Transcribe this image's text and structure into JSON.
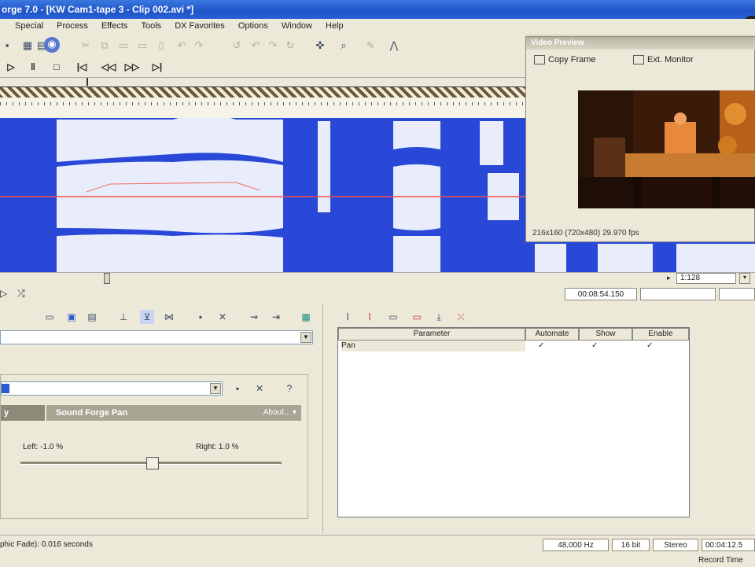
{
  "window": {
    "title": "orge 7.0 - [KW Cam1-tape 3 - Clip 002.avi *]"
  },
  "menu": [
    "Special",
    "Process",
    "Effects",
    "Tools",
    "DX Favorites",
    "Options",
    "Window",
    "Help"
  ],
  "preview": {
    "title": "Video Preview",
    "copy_frame": "Copy Frame",
    "ext_monitor": "Ext. Monitor",
    "info": "216x160  (720x480)  29.970 fps"
  },
  "position": {
    "zoom": "1:128",
    "cursor_time": "00:08:54.150"
  },
  "plugin": {
    "tab_label": "y",
    "name": "Sound Forge Pan",
    "about": "About...",
    "left_label": "Left: -1.0 %",
    "right_label": "Right: 1.0 %",
    "pan_value": 0.505
  },
  "param_table": {
    "headers": [
      "Parameter",
      "Automate",
      "Show",
      "Enable"
    ],
    "rows": [
      {
        "name": "Pan"
      }
    ]
  },
  "status": {
    "message": "phic Fade): 0.016 seconds",
    "sample_rate": "48,000 Hz",
    "bit_depth": "16 bit",
    "channels": "Stereo",
    "length": "00:04:12.5",
    "record_time": "Record Time"
  }
}
